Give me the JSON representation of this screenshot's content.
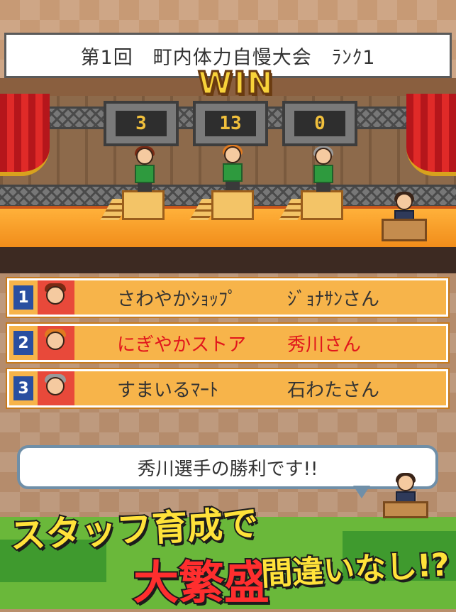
{
  "title_bar": {
    "text": "第1回　町内体力自慢大会　ﾗﾝｸ1"
  },
  "stage": {
    "win_label": "WIN",
    "scores": [
      "3",
      "13",
      "0"
    ]
  },
  "ranking": [
    {
      "rank": "1",
      "store": "さわやかｼｮｯﾌﾟ",
      "person": "ｼﾞｮﾅｻﾝさん",
      "highlight": false,
      "hair_color": "#7a2a14"
    },
    {
      "rank": "2",
      "store": "にぎやかストア",
      "person": "秀川さん",
      "highlight": true,
      "hair_color": "#e07a20"
    },
    {
      "rank": "3",
      "store": "すまいるﾏｰﾄ",
      "person": "石わたさん",
      "highlight": false,
      "hair_color": "#9a9a9a"
    }
  ],
  "speech": {
    "text": "秀川選手の勝利です!!"
  },
  "promo": {
    "line1": "スタッフ育成で",
    "line2": "大繁盛",
    "line3": "間違いなし!?"
  },
  "colors": {
    "win_gold": "#f7d23a",
    "winner_red": "#e1161c",
    "rank_orange": "#f7b44a",
    "rank_badge_blue": "#2a4fa0"
  }
}
